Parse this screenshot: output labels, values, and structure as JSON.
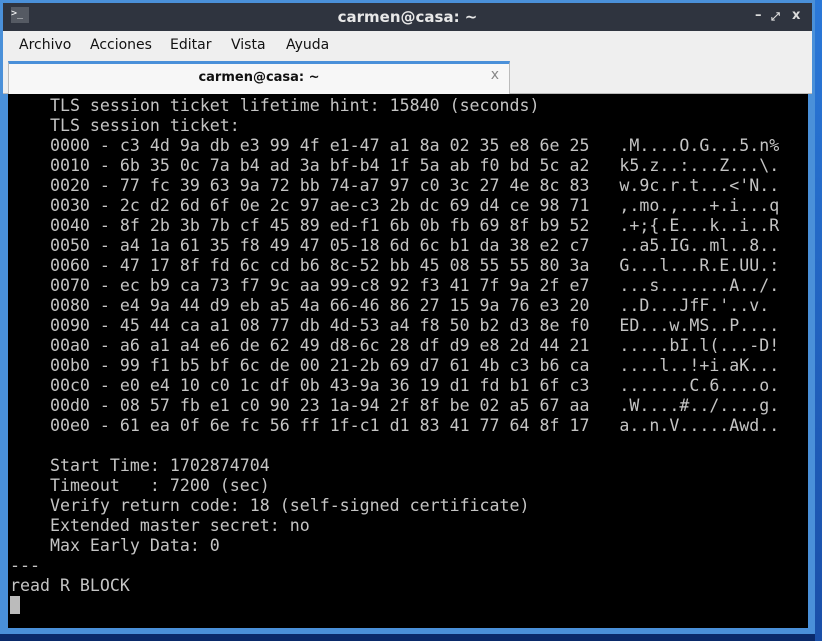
{
  "window": {
    "title": "carmen@casa: ~",
    "terminal_icon": ">_",
    "controls": {
      "minimize": "–",
      "maximize": "⤢",
      "close": "x"
    }
  },
  "menu": [
    "Archivo",
    "Acciones",
    "Editar",
    "Vista",
    "Ayuda"
  ],
  "tab": {
    "label": "carmen@casa: ~",
    "close": "x"
  },
  "terminal": {
    "lines": [
      "    TLS session ticket lifetime hint: 15840 (seconds)",
      "    TLS session ticket:",
      "    0000 - c3 4d 9a db e3 99 4f e1-47 a1 8a 02 35 e8 6e 25   .M....O.G...5.n%",
      "    0010 - 6b 35 0c 7a b4 ad 3a bf-b4 1f 5a ab f0 bd 5c a2   k5.z..:...Z...\\.",
      "    0020 - 77 fc 39 63 9a 72 bb 74-a7 97 c0 3c 27 4e 8c 83   w.9c.r.t...<'N..",
      "    0030 - 2c d2 6d 6f 0e 2c 97 ae-c3 2b dc 69 d4 ce 98 71   ,.mo.,...+.i...q",
      "    0040 - 8f 2b 3b 7b cf 45 89 ed-f1 6b 0b fb 69 8f b9 52   .+;{.E...k..i..R",
      "    0050 - a4 1a 61 35 f8 49 47 05-18 6d 6c b1 da 38 e2 c7   ..a5.IG..ml..8..",
      "    0060 - 47 17 8f fd 6c cd b6 8c-52 bb 45 08 55 55 80 3a   G...l...R.E.UU.:",
      "    0070 - ec b9 ca 73 f7 9c aa 99-c8 92 f3 41 7f 9a 2f e7   ...s.......A../.",
      "    0080 - e4 9a 44 d9 eb a5 4a 66-46 86 27 15 9a 76 e3 20   ..D...JfF.'..v. ",
      "    0090 - 45 44 ca a1 08 77 db 4d-53 a4 f8 50 b2 d3 8e f0   ED...w.MS..P....",
      "    00a0 - a6 a1 a4 e6 de 62 49 d8-6c 28 df d9 e8 2d 44 21   .....bI.l(...-D!",
      "    00b0 - 99 f1 b5 bf 6c de 00 21-2b 69 d7 61 4b c3 b6 ca   ....l..!+i.aK...",
      "    00c0 - e0 e4 10 c0 1c df 0b 43-9a 36 19 d1 fd b1 6f c3   .......C.6....o.",
      "    00d0 - 08 57 fb e1 c0 90 23 1a-94 2f 8f be 02 a5 67 aa   .W....#../....g.",
      "    00e0 - 61 ea 0f 6e fc 56 ff 1f-c1 d1 83 41 77 64 8f 17   a..n.V.....Awd..",
      "",
      "    Start Time: 1702874704",
      "    Timeout   : 7200 (sec)",
      "    Verify return code: 18 (self-signed certificate)",
      "    Extended master secret: no",
      "    Max Early Data: 0",
      "---",
      "read R BLOCK"
    ]
  }
}
